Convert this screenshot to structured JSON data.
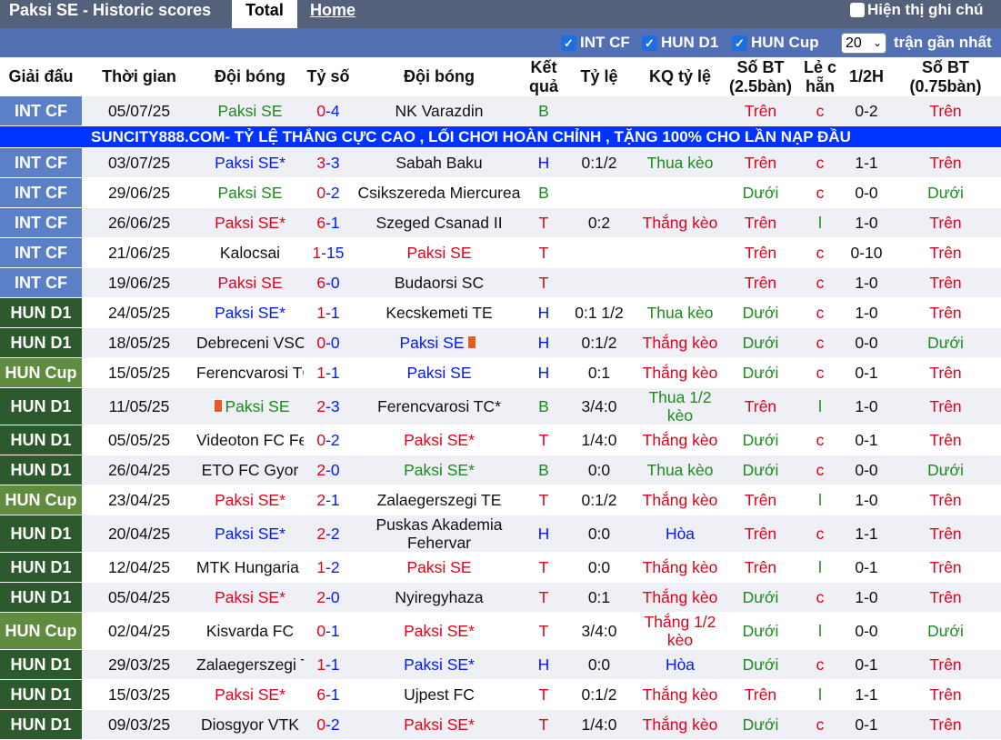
{
  "header": {
    "title": "Paksi SE - Historic scores",
    "tab_total": "Total",
    "tab_home": "Home",
    "hide_label": "Hiện thị ghi chú"
  },
  "filters": {
    "items": [
      {
        "label": "INT CF",
        "checked": true
      },
      {
        "label": "HUN D1",
        "checked": true
      },
      {
        "label": "HUN Cup",
        "checked": true
      }
    ],
    "count": "20",
    "recent_label": "trận gần nhất"
  },
  "columns": [
    "Giải đấu",
    "Thời gian",
    "Đội bóng",
    "Tỷ số",
    "Đội bóng",
    "Kết quả",
    "Tỷ lệ",
    "KQ tỷ lệ",
    "Số BT (2.5bàn)",
    "Lẻ c hẵn",
    "1/2H",
    "Số BT (0.75bàn)"
  ],
  "banner": "SUNCITY888.COM- TỶ LỆ THẮNG CỰC CAO , LỐI CHƠI HOÀN CHỈNH , TẶNG 100% CHO LẦN NẠP ĐẦU",
  "rows": [
    {
      "league": "INT CF",
      "lt": "cf",
      "date": "05/07/25",
      "home": "Paksi SE",
      "hc": "green",
      "hs": "0",
      "as": "4",
      "away": "NK Varazdin",
      "ac": "black",
      "res": "B",
      "rc": "green",
      "odds": "",
      "kq": "",
      "kqc": "",
      "ou": "Trên",
      "ouc": "red",
      "oe": "c",
      "oec": "red",
      "half": "0-2",
      "ou2": "Trên",
      "ou2c": "red"
    },
    {
      "banner": true
    },
    {
      "league": "INT CF",
      "lt": "cf",
      "date": "03/07/25",
      "home": "Paksi SE*",
      "hc": "blue",
      "hs": "3",
      "as": "3",
      "away": "Sabah Baku",
      "ac": "black",
      "res": "H",
      "rc": "blue",
      "odds": "0:1/2",
      "kq": "Thua kèo",
      "kqc": "green",
      "ou": "Trên",
      "ouc": "red",
      "oe": "c",
      "oec": "red",
      "half": "1-1",
      "ou2": "Trên",
      "ou2c": "red"
    },
    {
      "league": "INT CF",
      "lt": "cf",
      "date": "29/06/25",
      "home": "Paksi SE",
      "hc": "green",
      "hs": "0",
      "as": "2",
      "away": "Csikszereda Miercurea",
      "ac": "black",
      "res": "B",
      "rc": "green",
      "odds": "",
      "kq": "",
      "kqc": "",
      "ou": "Dưới",
      "ouc": "green",
      "oe": "c",
      "oec": "red",
      "half": "0-0",
      "ou2": "Dưới",
      "ou2c": "green"
    },
    {
      "league": "INT CF",
      "lt": "cf",
      "date": "26/06/25",
      "home": "Paksi SE*",
      "hc": "red",
      "hs": "6",
      "as": "1",
      "away": "Szeged Csanad II",
      "ac": "black",
      "res": "T",
      "rc": "red",
      "odds": "0:2",
      "kq": "Thắng kèo",
      "kqc": "red",
      "ou": "Trên",
      "ouc": "red",
      "oe": "l",
      "oec": "green",
      "half": "1-0",
      "ou2": "Trên",
      "ou2c": "red"
    },
    {
      "league": "INT CF",
      "lt": "cf",
      "date": "21/06/25",
      "home": "Kalocsai",
      "hc": "black",
      "hs": "1",
      "as": "15",
      "away": "Paksi SE",
      "ac": "red",
      "res": "T",
      "rc": "red",
      "odds": "",
      "kq": "",
      "kqc": "",
      "ou": "Trên",
      "ouc": "red",
      "oe": "c",
      "oec": "red",
      "half": "0-10",
      "ou2": "Trên",
      "ou2c": "red"
    },
    {
      "league": "INT CF",
      "lt": "cf",
      "date": "19/06/25",
      "home": "Paksi SE",
      "hc": "red",
      "hs": "6",
      "as": "0",
      "away": "Budaorsi SC",
      "ac": "black",
      "res": "T",
      "rc": "red",
      "odds": "",
      "kq": "",
      "kqc": "",
      "ou": "Trên",
      "ouc": "red",
      "oe": "c",
      "oec": "red",
      "half": "1-0",
      "ou2": "Trên",
      "ou2c": "red"
    },
    {
      "league": "HUN D1",
      "lt": "d1",
      "date": "24/05/25",
      "home": "Paksi SE*",
      "hc": "blue",
      "hs": "1",
      "as": "1",
      "away": "Kecskemeti TE",
      "ac": "black",
      "res": "H",
      "rc": "blue",
      "odds": "0:1 1/2",
      "kq": "Thua kèo",
      "kqc": "green",
      "ou": "Dưới",
      "ouc": "green",
      "oe": "c",
      "oec": "red",
      "half": "1-0",
      "ou2": "Trên",
      "ou2c": "red"
    },
    {
      "league": "HUN D1",
      "lt": "d1",
      "date": "18/05/25",
      "home": "Debreceni VSC*",
      "hc": "black",
      "hs": "0",
      "as": "0",
      "away": "Paksi SE",
      "ac": "blue",
      "acard": true,
      "res": "H",
      "rc": "blue",
      "odds": "0:1/2",
      "kq": "Thắng kèo",
      "kqc": "red",
      "ou": "Dưới",
      "ouc": "green",
      "oe": "c",
      "oec": "red",
      "half": "0-0",
      "ou2": "Dưới",
      "ou2c": "green"
    },
    {
      "league": "HUN Cup",
      "lt": "cup",
      "date": "15/05/25",
      "home": "Ferencvarosi TC(T)*",
      "hc": "black",
      "hs": "1",
      "as": "1",
      "away": "Paksi SE",
      "ac": "blue",
      "res": "H",
      "rc": "blue",
      "odds": "0:1",
      "kq": "Thắng kèo",
      "kqc": "red",
      "ou": "Dưới",
      "ouc": "green",
      "oe": "c",
      "oec": "red",
      "half": "0-1",
      "ou2": "Trên",
      "ou2c": "red"
    },
    {
      "league": "HUN D1",
      "lt": "d1",
      "date": "11/05/25",
      "home": "Paksi SE",
      "hc": "green",
      "hcard": true,
      "hs": "2",
      "as": "3",
      "away": "Ferencvarosi TC*",
      "ac": "black",
      "res": "B",
      "rc": "green",
      "odds": "3/4:0",
      "kq": "Thua 1/2 kèo",
      "kqc": "green",
      "kqwrap": true,
      "ou": "Trên",
      "ouc": "red",
      "oe": "l",
      "oec": "green",
      "half": "1-0",
      "ou2": "Trên",
      "ou2c": "red",
      "dbl": true
    },
    {
      "league": "HUN D1",
      "lt": "d1",
      "date": "05/05/25",
      "home": "Videoton FC Fehervar",
      "hc": "black",
      "hs": "0",
      "as": "2",
      "away": "Paksi SE*",
      "ac": "red",
      "res": "T",
      "rc": "red",
      "odds": "1/4:0",
      "kq": "Thắng kèo",
      "kqc": "red",
      "ou": "Dưới",
      "ouc": "green",
      "oe": "c",
      "oec": "red",
      "half": "0-1",
      "ou2": "Trên",
      "ou2c": "red"
    },
    {
      "league": "HUN D1",
      "lt": "d1",
      "date": "26/04/25",
      "home": "ETO FC Gyor",
      "hc": "black",
      "hs": "2",
      "as": "0",
      "away": "Paksi SE*",
      "ac": "green",
      "res": "B",
      "rc": "green",
      "odds": "0:0",
      "kq": "Thua kèo",
      "kqc": "green",
      "ou": "Dưới",
      "ouc": "green",
      "oe": "c",
      "oec": "red",
      "half": "0-0",
      "ou2": "Dưới",
      "ou2c": "green"
    },
    {
      "league": "HUN Cup",
      "lt": "cup",
      "date": "23/04/25",
      "home": "Paksi SE*",
      "hc": "red",
      "hs": "2",
      "as": "1",
      "away": "Zalaegerszegi TE",
      "ac": "black",
      "res": "T",
      "rc": "red",
      "odds": "0:1/2",
      "kq": "Thắng kèo",
      "kqc": "red",
      "ou": "Trên",
      "ouc": "red",
      "oe": "l",
      "oec": "green",
      "half": "1-0",
      "ou2": "Trên",
      "ou2c": "red"
    },
    {
      "league": "HUN D1",
      "lt": "d1",
      "date": "20/04/25",
      "home": "Paksi SE*",
      "hc": "blue",
      "hs": "2",
      "as": "2",
      "away": "Puskas Akademia Fehervar",
      "ac": "black",
      "awrap": true,
      "res": "H",
      "rc": "blue",
      "odds": "0:0",
      "kq": "Hòa",
      "kqc": "blue",
      "ou": "Trên",
      "ouc": "red",
      "oe": "c",
      "oec": "red",
      "half": "1-1",
      "ou2": "Trên",
      "ou2c": "red",
      "dbl": true
    },
    {
      "league": "HUN D1",
      "lt": "d1",
      "date": "12/04/25",
      "home": "MTK Hungaria FC*",
      "hc": "black",
      "hs": "1",
      "as": "2",
      "away": "Paksi SE",
      "ac": "red",
      "res": "T",
      "rc": "red",
      "odds": "0:0",
      "kq": "Thắng kèo",
      "kqc": "red",
      "ou": "Trên",
      "ouc": "red",
      "oe": "l",
      "oec": "green",
      "half": "0-1",
      "ou2": "Trên",
      "ou2c": "red"
    },
    {
      "league": "HUN D1",
      "lt": "d1",
      "date": "05/04/25",
      "home": "Paksi SE*",
      "hc": "red",
      "hs": "2",
      "as": "0",
      "away": "Nyiregyhaza",
      "ac": "black",
      "res": "T",
      "rc": "red",
      "odds": "0:1",
      "kq": "Thắng kèo",
      "kqc": "red",
      "ou": "Dưới",
      "ouc": "green",
      "oe": "c",
      "oec": "red",
      "half": "1-0",
      "ou2": "Trên",
      "ou2c": "red"
    },
    {
      "league": "HUN Cup",
      "lt": "cup",
      "date": "02/04/25",
      "home": "Kisvarda FC",
      "hc": "black",
      "hs": "0",
      "as": "1",
      "away": "Paksi SE*",
      "ac": "red",
      "res": "T",
      "rc": "red",
      "odds": "3/4:0",
      "kq": "Thắng 1/2 kèo",
      "kqc": "red",
      "kqwrap": true,
      "ou": "Dưới",
      "ouc": "green",
      "oe": "l",
      "oec": "green",
      "half": "0-0",
      "ou2": "Dưới",
      "ou2c": "green",
      "dbl": true
    },
    {
      "league": "HUN D1",
      "lt": "d1",
      "date": "29/03/25",
      "home": "Zalaegerszegi TE",
      "hc": "black",
      "hs": "1",
      "as": "1",
      "away": "Paksi SE*",
      "ac": "blue",
      "res": "H",
      "rc": "blue",
      "odds": "0:0",
      "kq": "Hòa",
      "kqc": "blue",
      "ou": "Dưới",
      "ouc": "green",
      "oe": "c",
      "oec": "red",
      "half": "0-1",
      "ou2": "Trên",
      "ou2c": "red"
    },
    {
      "league": "HUN D1",
      "lt": "d1",
      "date": "15/03/25",
      "home": "Paksi SE*",
      "hc": "red",
      "hs": "6",
      "as": "1",
      "away": "Ujpest FC",
      "ac": "black",
      "res": "T",
      "rc": "red",
      "odds": "0:1/2",
      "kq": "Thắng kèo",
      "kqc": "red",
      "ou": "Trên",
      "ouc": "red",
      "oe": "l",
      "oec": "green",
      "half": "1-1",
      "ou2": "Trên",
      "ou2c": "red"
    },
    {
      "league": "HUN D1",
      "lt": "d1",
      "date": "09/03/25",
      "home": "Diosgyor VTK",
      "hc": "black",
      "hs": "0",
      "as": "2",
      "away": "Paksi SE*",
      "ac": "red",
      "res": "T",
      "rc": "red",
      "odds": "1/4:0",
      "kq": "Thắng kèo",
      "kqc": "red",
      "ou": "Dưới",
      "ouc": "green",
      "oe": "c",
      "oec": "red",
      "half": "0-1",
      "ou2": "Trên",
      "ou2c": "red"
    }
  ]
}
